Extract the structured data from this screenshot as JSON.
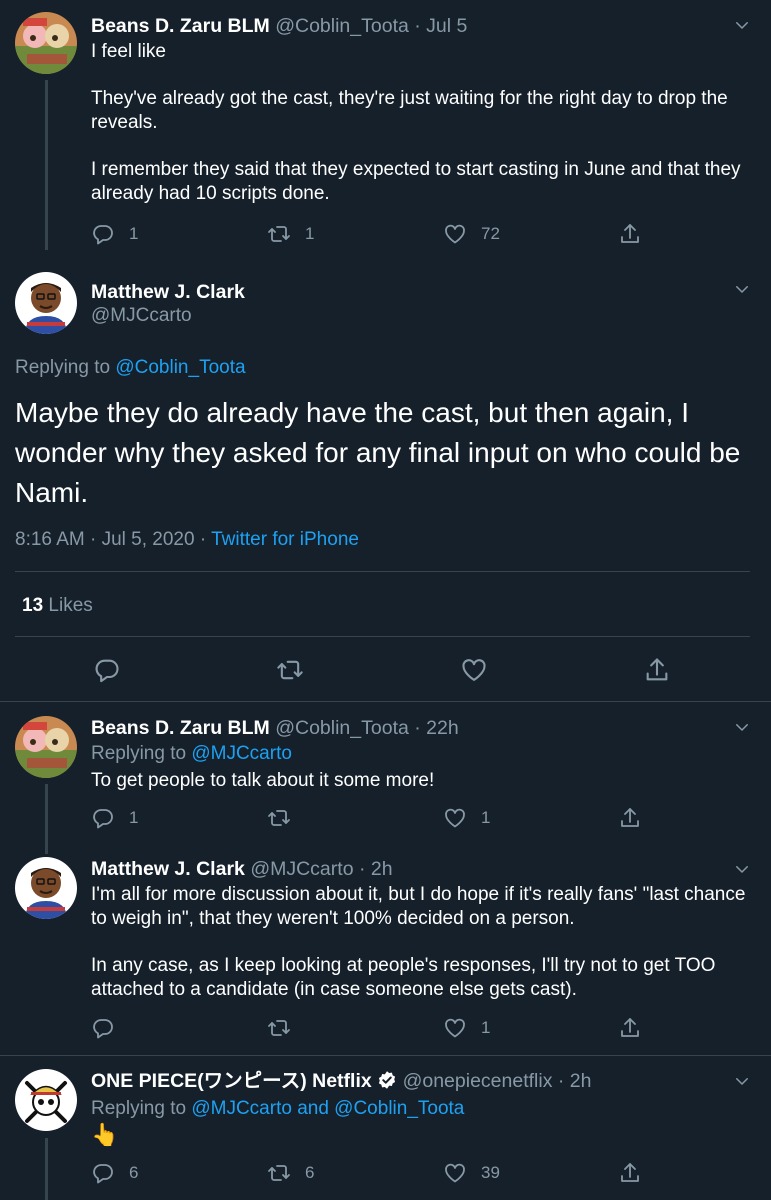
{
  "tweet1": {
    "name": "Beans D. Zaru BLM",
    "handle_time": "@Coblin_Toota · Jul 5",
    "lines": [
      "I feel like",
      "They've already got the cast, they're just waiting for the right day to drop the reveals.",
      "I remember they said that they expected to start casting in June and that they already had 10 scripts done."
    ],
    "replies": "1",
    "retweets": "1",
    "likes": "72"
  },
  "main": {
    "name": "Matthew J. Clark",
    "handle": "@MJCcarto",
    "replying_prefix": "Replying to",
    "replying_to": "@Coblin_Toota",
    "text": "Maybe they do already have the cast, but then again, I wonder why they asked for any final input on who could be Nami.",
    "timestamp": "8:16 AM · Jul 5, 2020 ·",
    "source": "Twitter for iPhone",
    "likes_count": "13",
    "likes_label": "Likes"
  },
  "reply1": {
    "name": "Beans D. Zaru BLM",
    "handle_time": "@Coblin_Toota · 22h",
    "replying_prefix": "Replying to",
    "replying_to": "@MJCcarto",
    "text": "To get people to talk about it some more!",
    "replies": "1",
    "retweets": "",
    "likes": "1"
  },
  "reply2": {
    "name": "Matthew J. Clark",
    "handle_time": "@MJCcarto · 2h",
    "lines": [
      "I'm all for more discussion about it, but I do hope if it's really fans' \"last chance to weigh in\", that they weren't 100% decided on a person.",
      "In any case, as I keep looking at people's responses, I'll try not to get TOO attached to a candidate (in case someone else gets cast)."
    ],
    "replies": "",
    "retweets": "",
    "likes": "1"
  },
  "reply3": {
    "name": "ONE PIECE(ワンピース) Netflix",
    "handle_time": "@onepiecenetflix · 2h",
    "replying_prefix": "Replying to",
    "replying_to": "@MJCcarto and @Coblin_Toota",
    "text": "👆",
    "replies": "6",
    "retweets": "6",
    "likes": "39"
  },
  "colors": {
    "background": "#15202b",
    "muted": "#8899a6",
    "link": "#1da1f2",
    "divider": "#38444d"
  },
  "icons": [
    "reply-icon",
    "retweet-icon",
    "like-icon",
    "share-icon",
    "chevron-down-icon",
    "verified-badge-icon"
  ]
}
